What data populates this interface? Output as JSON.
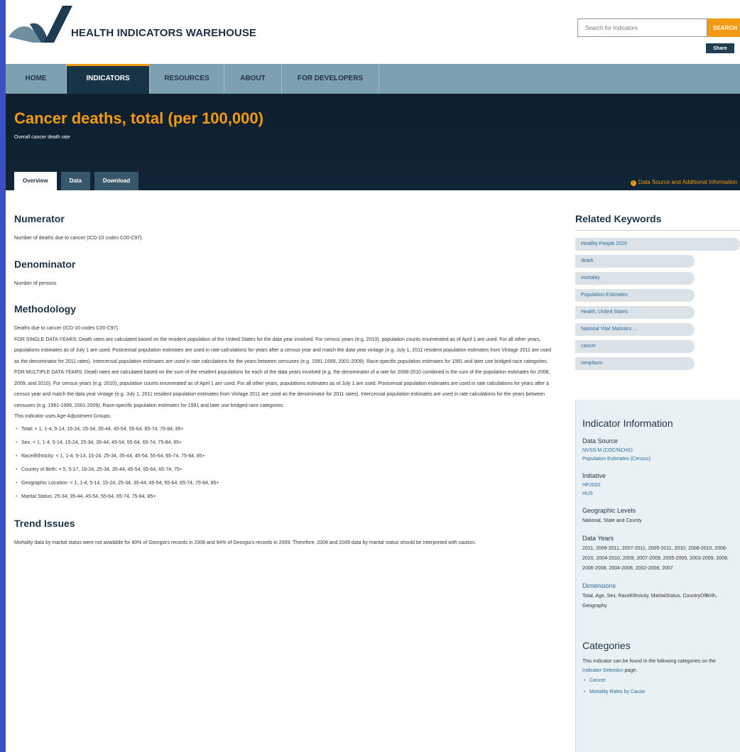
{
  "header": {
    "site_title": "HEALTH INDICATORS WAREHOUSE",
    "search_placeholder": "Search for Indicators",
    "search_label": "SEARCH",
    "share_label": "Share"
  },
  "nav": [
    {
      "label": "HOME",
      "active": false
    },
    {
      "label": "INDICATORS",
      "active": true
    },
    {
      "label": "RESOURCES",
      "active": false
    },
    {
      "label": "ABOUT",
      "active": false
    },
    {
      "label": "FOR DEVELOPERS",
      "active": false
    }
  ],
  "title_band": {
    "title": "Cancer deaths, total (per 100,000)",
    "subtitle": "Overall cancer death rate",
    "tabs": [
      {
        "label": "Overview",
        "active": true
      },
      {
        "label": "Data",
        "active": false
      },
      {
        "label": "Download",
        "active": false
      }
    ],
    "data_source_link": "Data Source and Additional Information"
  },
  "main": {
    "numerator_heading": "Numerator",
    "numerator_text": "Number of deaths due to cancer (ICD-10 codes C00-C97).",
    "denominator_heading": "Denominator",
    "denominator_text": "Number of persons",
    "methodology_heading": "Methodology",
    "methodology_line1": "Deaths due to cancer (ICD-10 codes C00-C97).",
    "methodology_single": "FOR SINGLE DATA YEARS: Death rates are calculated based on the resident population of the United States for the data year involved. For census years (e.g. 2010), population counts enumerated as of April 1 are used. For all other years, populations estimates as of July 1 are used. Postcensal population estimates are used in rate calculations for years after a census year and match the data year vintage (e.g. July 1, 2011 resident population estimates from Vintage 2011 are used as the denominator for 2011 rates). Intercensal population estimates are used in rate calculations for the years between censuses (e.g. 1991-1999, 2001-2009). Race-specific population estimates for 1991 and later use bridged-race categories.",
    "methodology_multiple": "FOR MULTIPLE DATA YEARS: Death rates are calculated based on the sum of the resident populations for each of the data years involved (e.g. the denominator of a rate for 2008-2010 combined is the sum of the population estimates for 2008, 2009, and 2010). For census years (e.g. 2010), population counts enumerated as of April 1 are used. For all other years, populations estimates as of July 1 are used. Postcensal population estimates are used in rate calculations for years after a census year and match the data year vintage (e.g. July 1, 2011 resident population estimates from Vintage 2011 are used as the denominator for 2011 rates). Intercensal population estimates are used in rate calculations for the years between censuses (e.g. 1991-1999, 2001-2009). Race-specific population estimates for 1991 and later use bridged-race categories.",
    "age_groups_intro": "This indicator uses Age-Adjustment Groups:",
    "age_groups": [
      "Total: < 1, 1-4, 5-14, 15-24, 25-34, 35-44, 45-54, 55-64, 65-74, 75-84, 85+",
      "Sex: < 1, 1-4, 5-14, 15-24, 25-34, 35-44, 45-54, 55-64, 65-74, 75-84, 85+",
      "Race/Ethnicity: < 1, 1-4, 5-14, 15-24, 25-34, 35-44, 45-54, 55-64, 65-74, 75-84, 85+",
      "Country of Birth: < 5, 5-17, 18-24, 25-34, 35-44, 45-54, 55-64, 65-74, 75+",
      "Geographic Location: < 1, 1-4, 5-14, 15-24, 25-34, 35-44, 45-54, 55-64, 65-74, 75-84, 85+",
      "Marital Status: 25-34, 35-44, 45-54, 55-64, 65-74, 75-84, 85+"
    ],
    "trend_heading": "Trend Issues",
    "trend_text": "Mortality data by marital status were not available for 80% of Georgia's records in 2008 and 94% of Georgia's records in 2009. Therefore, 2008 and 2009 data by marital status should be interpreted with caution."
  },
  "sidebar": {
    "related_title": "Related Keywords",
    "keywords": [
      "Healthy People 2020",
      "death",
      "mortality",
      "Population Estimates",
      "Health, United States",
      "National Vital Statistics ...",
      "cancer",
      "neoplasm"
    ],
    "info_title": "Indicator Information",
    "data_source_label": "Data Source",
    "data_source_links": [
      "NVSS-M (CDC/NCHS)",
      "Population Estimates (Census)"
    ],
    "initiative_label": "Initiative",
    "initiative_links": [
      "HP2020",
      "HUS"
    ],
    "geo_label": "Geographic Levels",
    "geo_text": "National, State and County",
    "years_label": "Data Years",
    "years_text": "2011, 2009-2011, 2007-2011, 2005-2011, 2010, 2008-2010, 2006-2010, 2004-2010, 2009, 2007-2009, 2005-2009, 2003-2009, 2008, 2006-2008, 2004-2008, 2002-2008, 2007",
    "dimensions_label": "Dimensions",
    "dimensions_text": "Total, Age, Sex, RaceEthnicity, MaritalStatus, CountryOfBirth, Geography",
    "categories_title": "Categories",
    "categories_intro_a": "This indicator can be found in the following categories on the ",
    "categories_intro_link": "Indicator Selection",
    "categories_intro_b": " page:",
    "categories": [
      "Cancer",
      "Mortality Rates by Cause"
    ]
  },
  "colors": {
    "accent_orange": "#f39a12",
    "nav_bg": "#7ea1b2",
    "title_band_bg": "#0f2130",
    "link_blue": "#2a6a99"
  }
}
